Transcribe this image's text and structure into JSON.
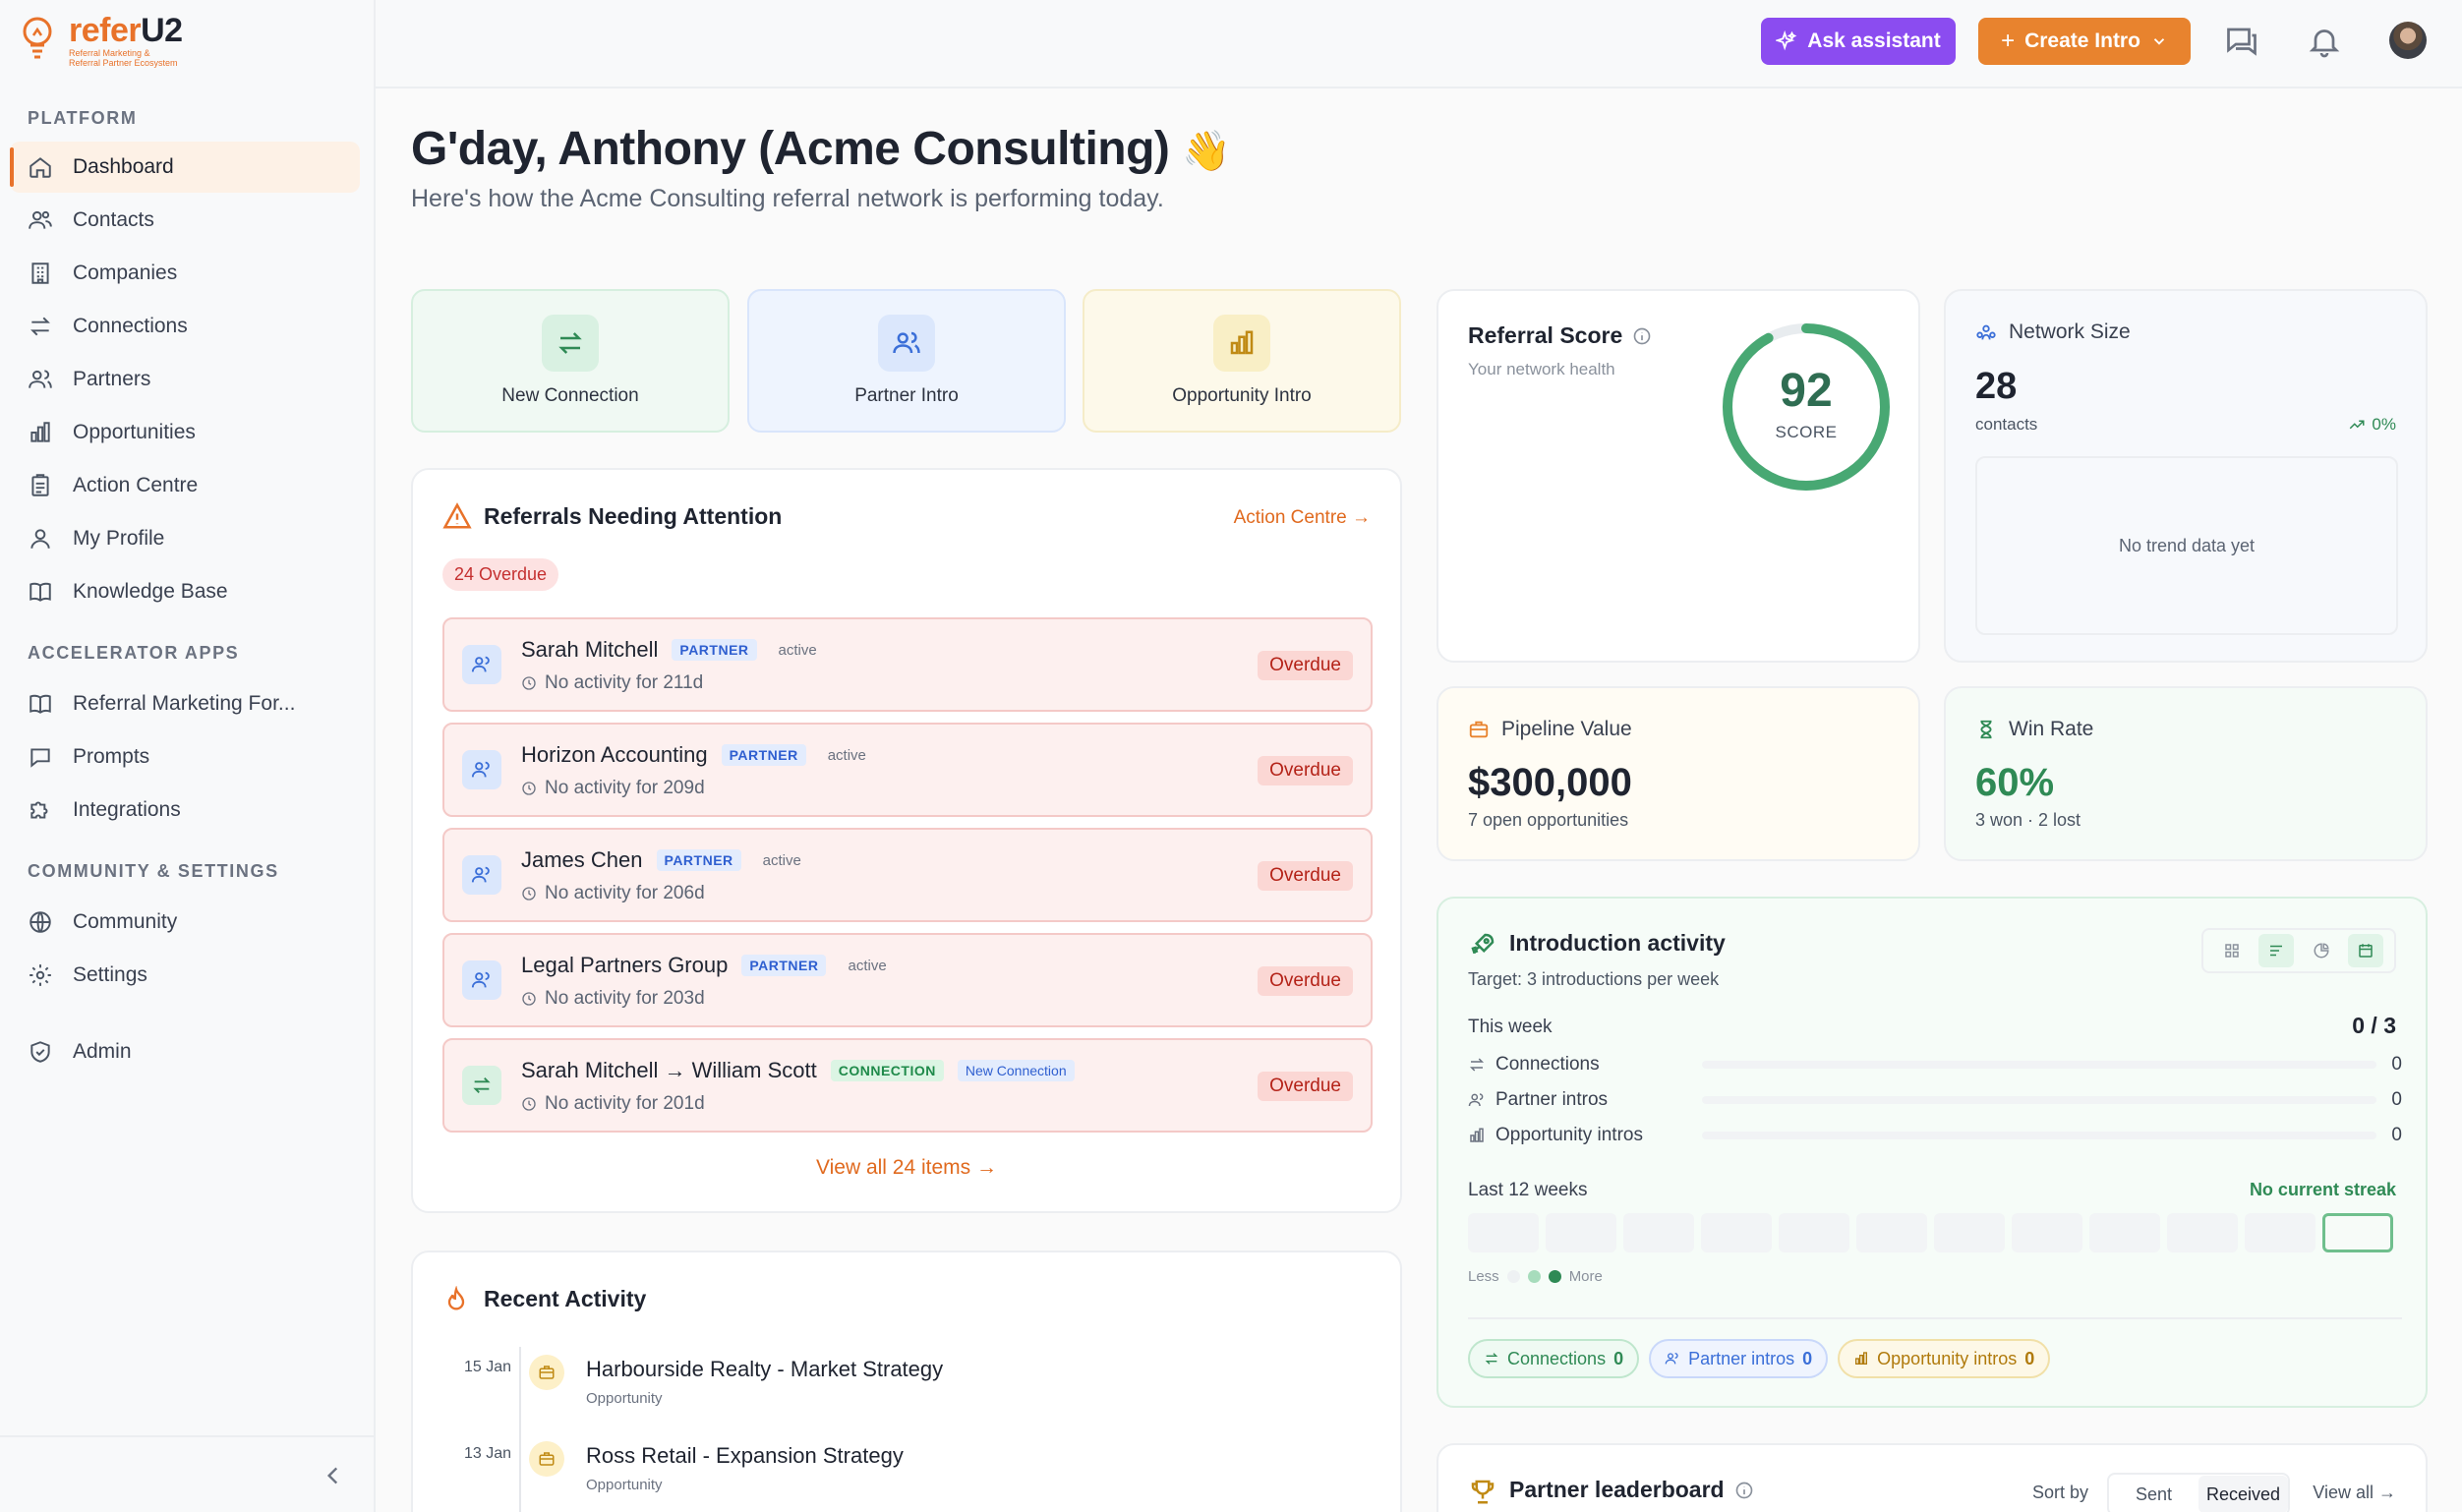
{
  "brand": {
    "name_prefix": "refer",
    "name_suffix": "U2",
    "tagline_1": "Referral Marketing &",
    "tagline_2": "Referral Partner Ecosystem",
    "color": "#e8722a"
  },
  "sidebar": {
    "platform_heading": "PLATFORM",
    "platform_items": [
      {
        "label": "Dashboard",
        "icon": "home-icon",
        "active": true
      },
      {
        "label": "Contacts",
        "icon": "contacts-icon"
      },
      {
        "label": "Companies",
        "icon": "building-icon"
      },
      {
        "label": "Connections",
        "icon": "arrows-icon"
      },
      {
        "label": "Partners",
        "icon": "users-icon"
      },
      {
        "label": "Opportunities",
        "icon": "bar-chart-icon"
      },
      {
        "label": "Action Centre",
        "icon": "clipboard-icon"
      },
      {
        "label": "My Profile",
        "icon": "user-icon"
      },
      {
        "label": "Knowledge Base",
        "icon": "book-icon"
      }
    ],
    "accelerator_heading": "ACCELERATOR APPS",
    "accelerator_items": [
      {
        "label": "Referral Marketing For...",
        "icon": "book-icon"
      },
      {
        "label": "Prompts",
        "icon": "chat-icon"
      },
      {
        "label": "Integrations",
        "icon": "puzzle-icon"
      }
    ],
    "community_heading": "COMMUNITY & SETTINGS",
    "community_items": [
      {
        "label": "Community",
        "icon": "globe-icon"
      },
      {
        "label": "Settings",
        "icon": "gear-icon"
      }
    ],
    "admin_label": "Admin"
  },
  "topbar": {
    "assistant_label": "Ask assistant",
    "create_label": "Create Intro"
  },
  "header": {
    "greeting": "G'day, Anthony (Acme Consulting)",
    "wave": "👋",
    "subtitle": "Here's how the Acme Consulting referral network is performing today."
  },
  "quick_actions": [
    {
      "label": "New Connection",
      "color": "#2f8a55"
    },
    {
      "label": "Partner Intro",
      "color": "#3b6fd8"
    },
    {
      "label": "Opportunity Intro",
      "color": "#c08a14"
    }
  ],
  "attention": {
    "title": "Referrals Needing Attention",
    "link": "Action Centre →",
    "overdue_pill": "24 Overdue",
    "rows": [
      {
        "name": "Sarah Mitchell",
        "tag": "PARTNER",
        "status": "active",
        "sub": "No activity for 211d",
        "badge": "Overdue"
      },
      {
        "name": "Horizon Accounting",
        "tag": "PARTNER",
        "status": "active",
        "sub": "No activity for 209d",
        "badge": "Overdue"
      },
      {
        "name": "James Chen",
        "tag": "PARTNER",
        "status": "active",
        "sub": "No activity for 206d",
        "badge": "Overdue"
      },
      {
        "name": "Legal Partners Group",
        "tag": "PARTNER",
        "status": "active",
        "sub": "No activity for 203d",
        "badge": "Overdue"
      },
      {
        "name": "Sarah Mitchell → William Scott",
        "tag": "CONNECTION",
        "status": "New Connection",
        "sub": "No activity for 201d",
        "badge": "Overdue"
      }
    ],
    "view_all": "View all 24 items →"
  },
  "recent": {
    "title": "Recent Activity",
    "items": [
      {
        "date": "15 Jan",
        "name": "Harbourside Realty - Market Strategy",
        "type": "Opportunity"
      },
      {
        "date": "13 Jan",
        "name": "Ross Retail - Expansion Strategy",
        "type": "Opportunity"
      }
    ]
  },
  "score": {
    "title": "Referral Score",
    "subtitle": "Your network health",
    "value": "92",
    "caption": "SCORE",
    "fraction": 0.92
  },
  "network": {
    "title": "Network Size",
    "value": "28",
    "unit": "contacts",
    "change": "0%",
    "empty": "No trend data yet"
  },
  "pipeline": {
    "title": "Pipeline Value",
    "value": "$300,000",
    "sub": "7 open opportunities"
  },
  "winrate": {
    "title": "Win Rate",
    "value": "60%",
    "sub": "3 won · 2 lost"
  },
  "intro": {
    "title": "Introduction activity",
    "target": "Target: 3 introductions per week",
    "week_label": "This week",
    "week_value": "0 / 3",
    "rows": [
      {
        "label": "Connections",
        "value": "0",
        "progress": 0
      },
      {
        "label": "Partner intros",
        "value": "0",
        "progress": 0
      },
      {
        "label": "Opportunity intros",
        "value": "0",
        "progress": 0
      }
    ],
    "last12": "Last 12 weeks",
    "streak": "No current streak",
    "legend_less": "Less",
    "legend_more": "More",
    "chips": [
      {
        "label": "Connections",
        "value": "0",
        "color": "#2f8a55"
      },
      {
        "label": "Partner intros",
        "value": "0",
        "color": "#3b6fd8"
      },
      {
        "label": "Opportunity intros",
        "value": "0",
        "color": "#c08a14"
      }
    ]
  },
  "leaderboard": {
    "title": "Partner leaderboard",
    "sort_by": "Sort by",
    "sent": "Sent",
    "received": "Received",
    "view_all": "View all →"
  }
}
